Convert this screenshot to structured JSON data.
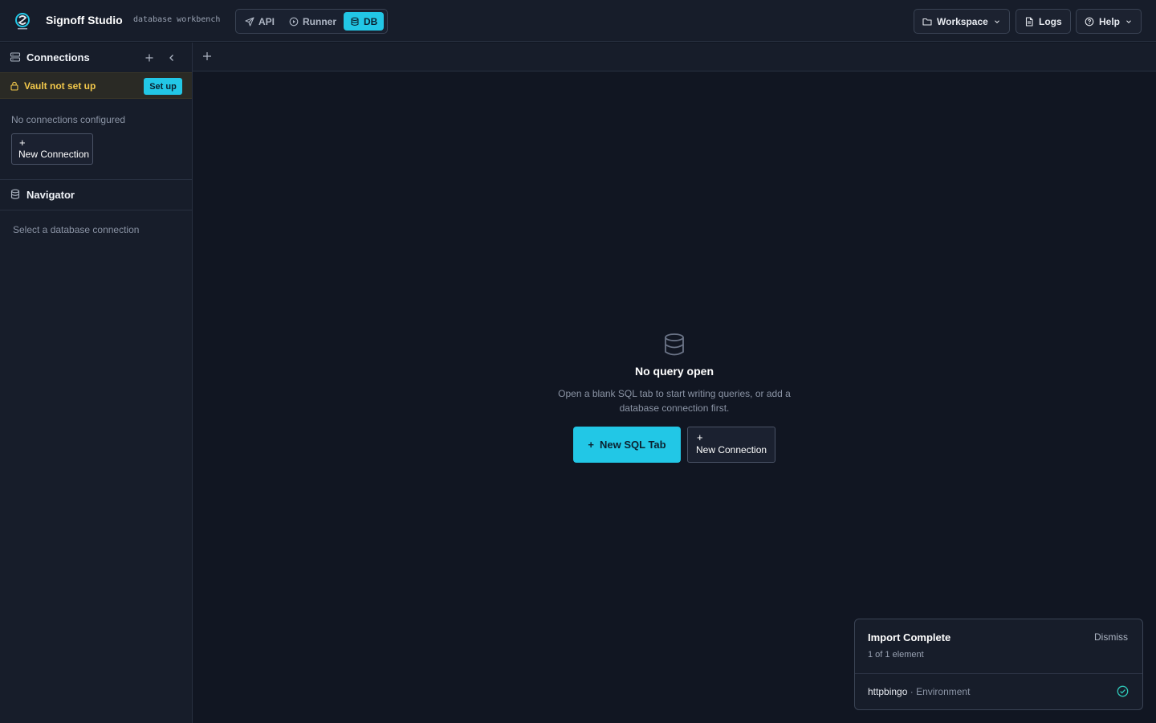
{
  "app": {
    "title": "Signoff Studio",
    "subtitle": "database workbench",
    "logo_icon": "signoff-logo",
    "accent_color": "#22c7e6"
  },
  "modes": [
    {
      "label": "API",
      "icon": "send-icon",
      "active": false
    },
    {
      "label": "Runner",
      "icon": "play-circle-icon",
      "active": false
    },
    {
      "label": "DB",
      "icon": "database-icon",
      "active": true
    }
  ],
  "header_actions": {
    "workspace": "Workspace",
    "logs": "Logs",
    "help": "Help"
  },
  "sidebar": {
    "connections": {
      "title": "Connections",
      "vault_warning": "Vault not set up",
      "setup_label": "Set up",
      "empty_text": "No connections configured",
      "new_connection_plus": "+",
      "new_connection_label": "New Connection"
    },
    "navigator": {
      "title": "Navigator",
      "empty_text": "Select a database connection"
    }
  },
  "empty_state": {
    "title": "No query open",
    "description": "Open a blank SQL tab to start writing queries, or add a database connection first.",
    "primary_plus": "+",
    "primary_label": "New SQL Tab",
    "secondary_plus": "+",
    "secondary_label": "New Connection"
  },
  "toast": {
    "title": "Import Complete",
    "dismiss": "Dismiss",
    "summary": "1 of 1 element",
    "item_name": "httpbingo",
    "item_separator": "·",
    "item_kind": "Environment",
    "status_color": "#2fc8b8"
  }
}
